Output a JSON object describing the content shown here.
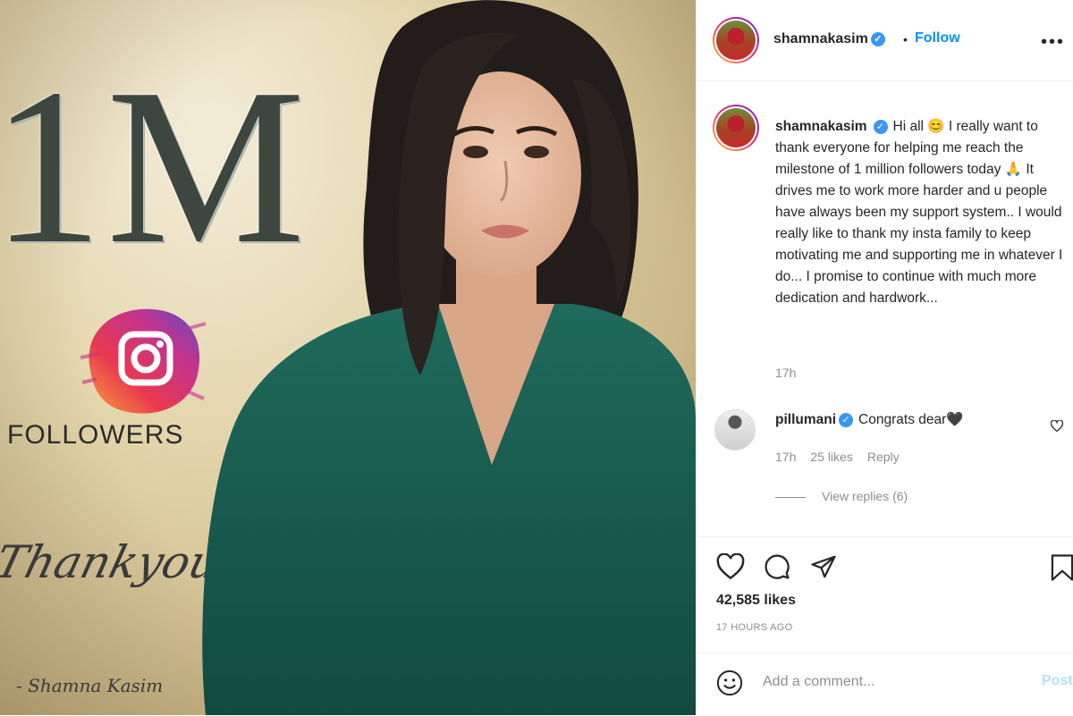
{
  "photo": {
    "big_text": "1M",
    "followers_text": "FOLLOWERS",
    "thankyou_text": "Thankyou All",
    "signature_text": "- Shamna Kasim"
  },
  "header": {
    "username": "shamnakasim",
    "separator": "•",
    "follow_label": "Follow",
    "more_icon": "more-options-icon"
  },
  "caption": {
    "username": "shamnakasim",
    "text": "Hi all 😊 I really want to thank everyone for helping me reach the milestone of 1 million followers today 🙏 It drives me to work more harder and u people have always been my support system.. I would really like to thank my insta family to keep motivating me and supporting me in whatever I do... I promise to continue with much more dedication and hardwork...",
    "time": "17h"
  },
  "comment": {
    "username": "pillumani",
    "text": "Congrats dear🖤",
    "time": "17h",
    "likes": "25 likes",
    "reply_label": "Reply",
    "view_replies": "View replies (6)"
  },
  "actions": {
    "likes": "42,585 likes",
    "timestamp": "17 HOURS AGO"
  },
  "add_comment": {
    "placeholder": "Add a comment...",
    "post_label": "Post"
  },
  "colors": {
    "accent": "#0095f6",
    "verified": "#3897f0",
    "muted": "#8e8e8e"
  }
}
